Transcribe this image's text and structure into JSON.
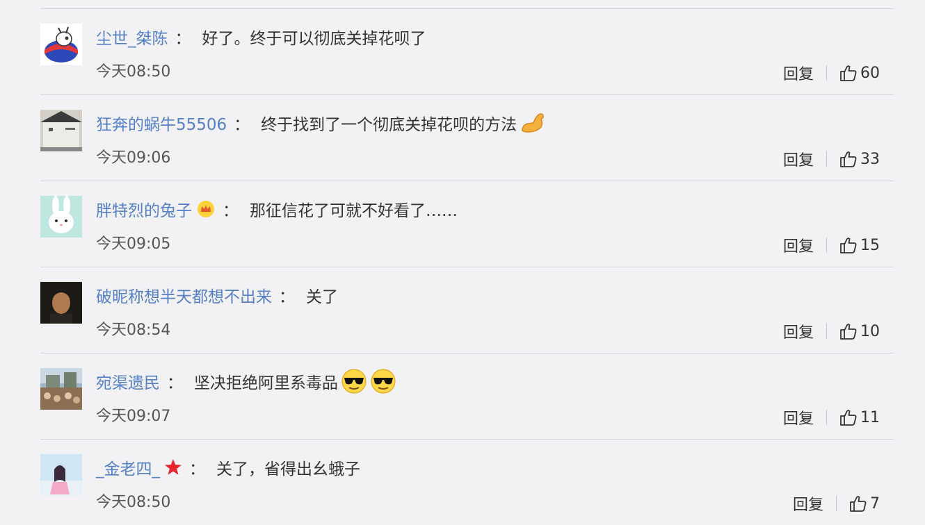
{
  "comments": [
    {
      "username": "尘世_桀陈",
      "separator": "：",
      "text": "好了。终于可以彻底关掉花呗了",
      "time": "今天08:50",
      "reply_label": "回复",
      "likes": "60",
      "badges": [],
      "emojis": []
    },
    {
      "username": "狂奔的蜗牛55506",
      "separator": "：",
      "text": "终于找到了一个彻底关掉花呗的方法",
      "time": "今天09:06",
      "reply_label": "回复",
      "likes": "33",
      "badges": [],
      "emojis": [
        "flexed-biceps-emoji"
      ]
    },
    {
      "username": "胖特烈的兔子",
      "separator": "：",
      "text": "那征信花了可就不好看了……",
      "time": "今天09:05",
      "reply_label": "回复",
      "likes": "15",
      "badges": [
        "crown-badge-icon"
      ],
      "emojis": []
    },
    {
      "username": "破昵称想半天都想不出来",
      "separator": "：",
      "text": "关了",
      "time": "今天08:54",
      "reply_label": "回复",
      "likes": "10",
      "badges": [],
      "emojis": []
    },
    {
      "username": "宛渠遗民",
      "separator": "：",
      "text": "坚决拒绝阿里系毒品",
      "time": "今天09:07",
      "reply_label": "回复",
      "likes": "11",
      "badges": [],
      "emojis": [
        "sunglasses-emoji",
        "sunglasses-emoji"
      ]
    },
    {
      "username": "_金老四_",
      "separator": "：",
      "text": "关了，省得出幺蛾子",
      "time": "今天08:50",
      "reply_label": "回复",
      "likes": "7",
      "badges": [
        "red-star-badge-icon"
      ],
      "emojis": []
    }
  ],
  "colors": {
    "background": "#f2f2f5",
    "username": "#5580c8",
    "divider": "#d6d6dc",
    "text": "#333333",
    "timestamp": "#555555"
  },
  "icons": {
    "like": "thumbs-up-icon"
  }
}
